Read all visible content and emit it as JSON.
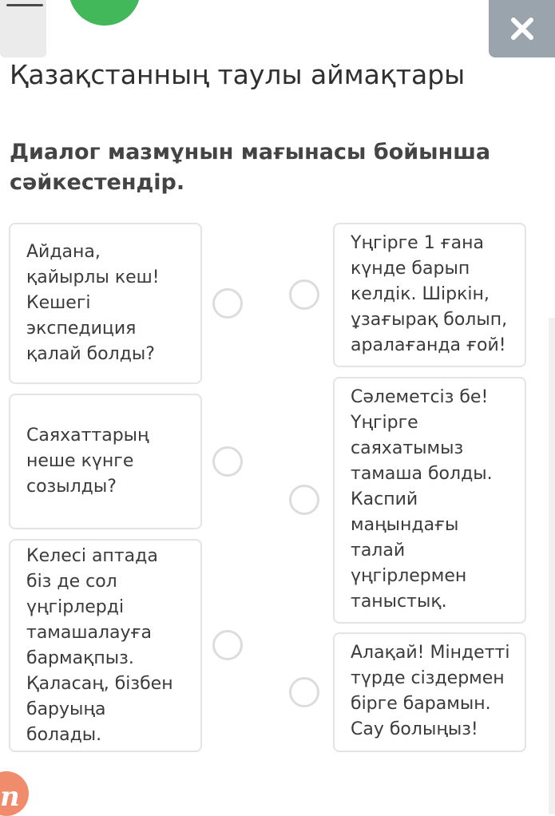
{
  "header": {
    "title": "Қазақстанның таулы аймақтары",
    "close_icon": "close-x-icon",
    "menu_icon": "menu-icon"
  },
  "instruction": "Диалог мазмұнын мағынасы бойынша сәйкестендір.",
  "left_items": [
    "Айдана, қайырлы кеш! Кешегі экспедиция қалай болды?",
    "Саяхаттарың неше күнге созылды?",
    "Келесі аптада біз де сол үңгірлерді тамашалауға бармақпыз. Қаласаң, бізбен баруыңа болады."
  ],
  "right_items": [
    "Үңгірге 1 ғана күнде барып келдік. Шіркін, ұзағырақ болып, аралағанда ғой!",
    "Сәлеметсіз бе! Үңгірге саяхатымыз тамаша болды. Каспий маңындағы талай үңгірлермен таныстық.",
    "Алақай! Міндетті түрде сіздермен бірге барамын. Сау болыңыз!"
  ],
  "colors": {
    "accent_green": "#43b85a",
    "close_button": "#9aa4ad",
    "card_border": "#e4e4e4",
    "logo": "#f08c6c"
  }
}
